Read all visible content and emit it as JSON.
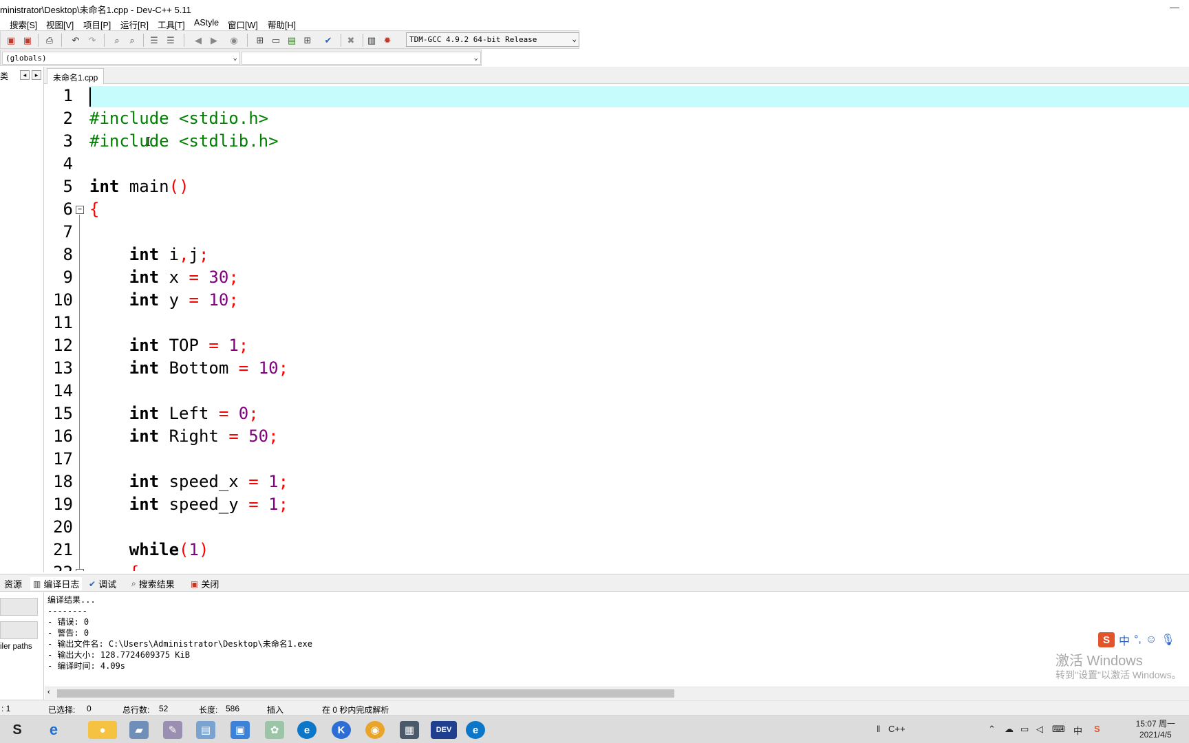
{
  "window": {
    "title": "ministrator\\Desktop\\未命名1.cpp - Dev-C++ 5.11",
    "minimize_glyph": "—"
  },
  "menu": [
    "搜索[S]",
    "视图[V]",
    "项目[P]",
    "运行[R]",
    "工具[T]",
    "AStyle",
    "窗口[W]",
    "帮助[H]"
  ],
  "toolbar": {
    "compiler": "TDM-GCC 4.9.2 64-bit Release",
    "icons": [
      "compile-icon",
      "compile-run-icon",
      "print-icon",
      "undo-icon",
      "redo-icon",
      "find-icon",
      "replace-icon",
      "indent-icon",
      "unindent-icon",
      "bookmark-icon",
      "goto-icon",
      "new-project-icon",
      "open-project-icon",
      "class-browser-icon",
      "layout-icon",
      "check-icon",
      "delete-icon",
      "profile-icon",
      "debug-icon"
    ]
  },
  "scope": {
    "globals": "(globals)",
    "member": ""
  },
  "left_panel": {
    "tab_label": "类"
  },
  "editor": {
    "file_tab": "未命名1.cpp",
    "line_numbers": [
      "1",
      "2",
      "3",
      "4",
      "5",
      "6",
      "7",
      "8",
      "9",
      "10",
      "11",
      "12",
      "13",
      "14",
      "15",
      "16",
      "17",
      "18",
      "19",
      "20",
      "21",
      "22"
    ],
    "lines": [
      "",
      "#include <stdio.h>",
      "#include <stdlib.h>",
      "",
      "int main()",
      "{",
      "",
      "    int i,j;",
      "    int x = 30;",
      "    int y = 10;",
      "",
      "    int TOP = 1;",
      "    int Bottom = 10;",
      "",
      "    int Left = 0;",
      "    int Right = 50;",
      "",
      "    int speed_x = 1;",
      "    int speed_y = 1;",
      "",
      "    while(1)",
      "    {"
    ]
  },
  "bottom_tabs": [
    {
      "label": "资源",
      "icon": "resource-icon"
    },
    {
      "label": "编译日志",
      "icon": "chart-icon"
    },
    {
      "label": "调试",
      "icon": "check-icon"
    },
    {
      "label": "搜索结果",
      "icon": "search-icon"
    },
    {
      "label": "关闭",
      "icon": "close-icon"
    }
  ],
  "output_left": {
    "label": "iler paths"
  },
  "output": [
    "编译结果...",
    "--------",
    "- 错误: 0",
    "- 警告: 0",
    "- 输出文件名: C:\\Users\\Administrator\\Desktop\\未命名1.exe",
    "- 输出大小: 128.7724609375 KiB",
    "- 编译时间: 4.09s"
  ],
  "watermark": {
    "line1": "激活 Windows",
    "line2": "转到\"设置\"以激活 Windows。"
  },
  "ime": {
    "brand": "S",
    "mode": "中",
    "punct": "°,"
  },
  "status": {
    "line": ": 1",
    "selected_label": "已选择:",
    "selected_value": "0",
    "total_label": "总行数:",
    "total_value": "52",
    "length_label": "长度:",
    "length_value": "586",
    "mode": "插入",
    "parse": "在 0 秒内完成解析"
  },
  "taskbar": {
    "lang": "C++",
    "time": "15:07 周一",
    "date": "2021/4/5",
    "colors": {
      "wechat": "#f5c242",
      "edge": "#0c76c9",
      "dev": "#1f3f8f",
      "kingsoft": "#2d6ed6",
      "chrome": "#e8a52a"
    }
  }
}
